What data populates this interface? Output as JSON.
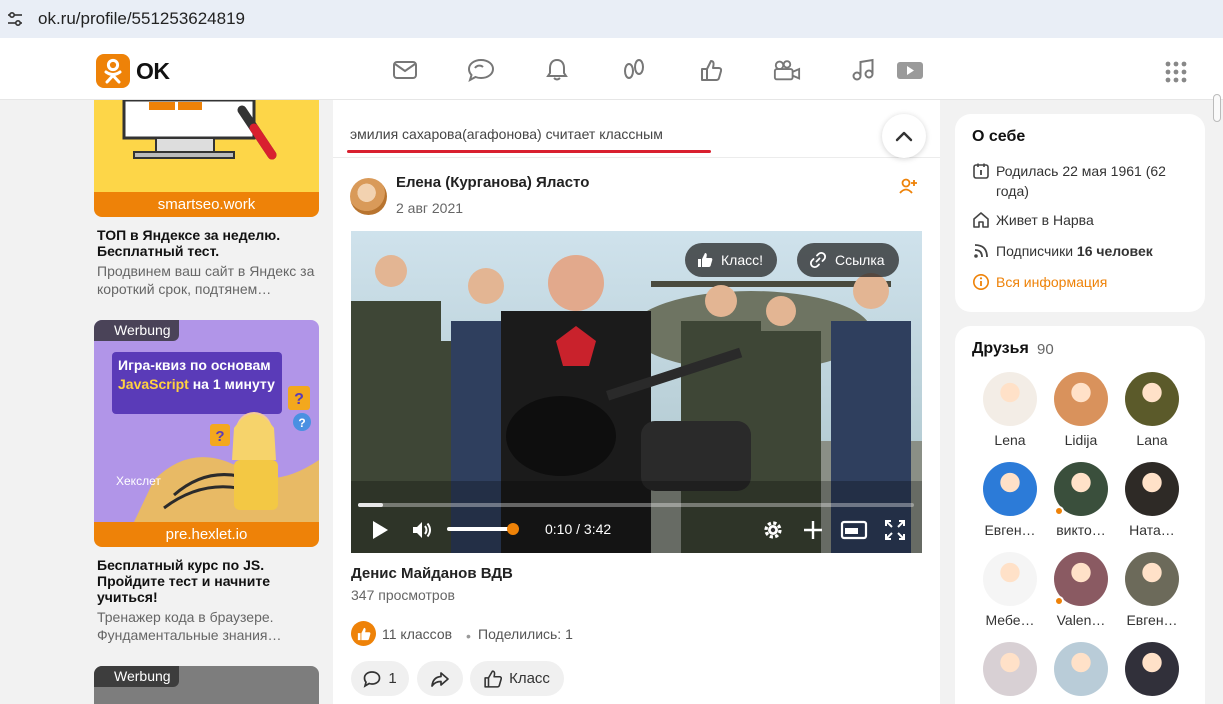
{
  "browser": {
    "url": "ok.ru/profile/551253624819"
  },
  "header": {
    "logo_text": "OK",
    "nav_icons": [
      "messages-icon",
      "discussions-icon",
      "notifications-icon",
      "guests-icon",
      "reactions-icon",
      "video-calls-icon",
      "music-icon",
      "video-icon"
    ],
    "active_nav": "notifications-icon"
  },
  "ads": [
    {
      "label": "",
      "domain": "smartseo.work",
      "title": "ТОП в Яндексе за неделю. Бесплатный тест.",
      "desc": "Продвинем ваш сайт в Яндекс за короткий срок, подтянем…"
    },
    {
      "label": "Werbung",
      "banner_text_1": "Игра-квиз по основам ",
      "banner_text_highlight": "JavaScript",
      "banner_text_2": " на 1 минуту",
      "brand": "Хекслет",
      "domain": "pre.hexlet.io",
      "title": "Бесплатный курс по JS. Пройдите тест и начните учиться!",
      "desc": "Тренажер кода в браузере. Фундаментальные знания…"
    },
    {
      "label": "Werbung"
    }
  ],
  "feed": {
    "caption": "эмилия сахарова(агафонова) считает классным",
    "post": {
      "author": "Елена (Курганова) Яласто",
      "date": "2 авг 2021",
      "video": {
        "class_label": "Класс!",
        "link_label": "Ссылка",
        "time": "0:10 / 3:42",
        "progress": 0.045,
        "volume": 0.9
      },
      "title": "Денис Майданов ВДВ",
      "views": "347 просмотров",
      "likes": "11 классов",
      "shares": "Поделились: 1",
      "comment_count": "1",
      "class_button": "Класс"
    }
  },
  "about": {
    "title": "О себе",
    "born": "Родилась 22 мая 1961 (62 года)",
    "lives": "Живет в Нарва",
    "subscribers_prefix": "Подписчики ",
    "subscribers_count": "16 человек",
    "all_info": "Вся информация"
  },
  "friends": {
    "title": "Друзья",
    "count": "90",
    "items": [
      {
        "name": "Lena",
        "color": "#f3ede6"
      },
      {
        "name": "Lidija",
        "color": "#d9925c"
      },
      {
        "name": "Lana",
        "color": "#5b5a2a"
      },
      {
        "name": "Евген…",
        "color": "#2c7bd8"
      },
      {
        "name": "викто…",
        "color": "#3a4f3c",
        "online": true
      },
      {
        "name": "Ната…",
        "color": "#2e2a26"
      },
      {
        "name": "Мебе…",
        "color": "#f5f5f5"
      },
      {
        "name": "Valen…",
        "color": "#8a5a62",
        "online": true
      },
      {
        "name": "Евген…",
        "color": "#6c6a5a"
      },
      {
        "name": "",
        "color": "#d8d0d4"
      },
      {
        "name": "",
        "color": "#b9ccd8"
      },
      {
        "name": "",
        "color": "#31303a"
      }
    ]
  },
  "colors": {
    "accent": "#ee8208",
    "underline": "#d9202f"
  }
}
